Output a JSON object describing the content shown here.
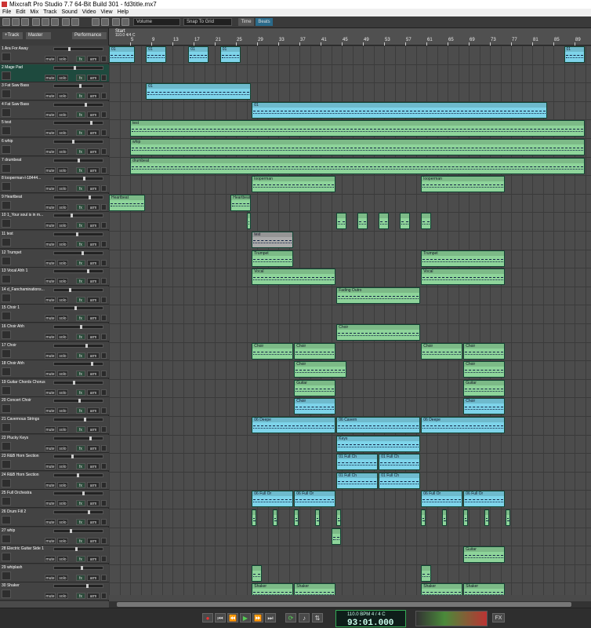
{
  "window": {
    "title": "Mixcraft Pro Studio 7.7 64-Bit Build 301 - fd3title.mx7"
  },
  "menu": [
    "File",
    "Edit",
    "Mix",
    "Track",
    "Sound",
    "Video",
    "View",
    "Help"
  ],
  "toolbar": {
    "volume_label": "Volume",
    "snap_label": "Snap To Grid",
    "time_tab": "Time",
    "beats_tab": "Beats"
  },
  "header": {
    "track_btn": "+Track",
    "master_btn": "Master",
    "performance_btn": "Performance"
  },
  "ruler": {
    "marker": "Start",
    "time": "110.0 4/4 C",
    "bars": [
      "5",
      "9",
      "13",
      "17",
      "21",
      "25",
      "29",
      "33",
      "37",
      "41",
      "45",
      "49",
      "53",
      "57",
      "61",
      "65",
      "69",
      "73",
      "77",
      "81",
      "85",
      "89"
    ]
  },
  "track_buttons": {
    "mute": "mute",
    "solo": "solo",
    "fx": "fx",
    "arm": "arm"
  },
  "tracks": [
    {
      "name": "1 Ara For Away",
      "color": "b"
    },
    {
      "name": "2 Mage Pad",
      "color": "b"
    },
    {
      "name": "3 Fat Saw Bass",
      "color": "b"
    },
    {
      "name": "4 Fat Saw Bass",
      "color": "b"
    },
    {
      "name": "5 test",
      "color": "g"
    },
    {
      "name": "6 whip",
      "color": "g"
    },
    {
      "name": "7 drumbeat",
      "color": "g"
    },
    {
      "name": "8 looperman-l-18444...",
      "color": "g"
    },
    {
      "name": "9 Heartbeat",
      "color": "g"
    },
    {
      "name": "10 1_Your soul is in m...",
      "color": "g"
    },
    {
      "name": "11 test",
      "color": "gr"
    },
    {
      "name": "12 Trumpet",
      "color": "g"
    },
    {
      "name": "13 Vocal Ahh 1",
      "color": "g"
    },
    {
      "name": "14 d_Fanchaminations...",
      "color": "g"
    },
    {
      "name": "15 Choir 1",
      "color": "g"
    },
    {
      "name": "16 Choir Ahh",
      "color": "g"
    },
    {
      "name": "17 Choir",
      "color": "g"
    },
    {
      "name": "18 Choir Ahh",
      "color": "g"
    },
    {
      "name": "19 Guitar Chords Chorus",
      "color": "g"
    },
    {
      "name": "20 Concert Choir",
      "color": "b"
    },
    {
      "name": "21 Cavernous Strings",
      "color": "b"
    },
    {
      "name": "22 Plucky Keys",
      "color": "b"
    },
    {
      "name": "23 R&B Horn Section",
      "color": "b"
    },
    {
      "name": "24 R&B Horn Section",
      "color": "b"
    },
    {
      "name": "25 Full Orchestra",
      "color": "b"
    },
    {
      "name": "26 Drum Fill 2",
      "color": "g"
    },
    {
      "name": "27 whip",
      "color": "g"
    },
    {
      "name": "28 Electric Guitar Side 1",
      "color": "g"
    },
    {
      "name": "29 whiplash",
      "color": "g"
    },
    {
      "name": "30 Shaker",
      "color": "g"
    }
  ],
  "clips": [
    {
      "t": 0,
      "s": 0,
      "e": 5,
      "c": "b",
      "l": "01"
    },
    {
      "t": 0,
      "s": 7,
      "e": 11,
      "c": "b",
      "l": "01"
    },
    {
      "t": 0,
      "s": 15,
      "e": 19,
      "c": "b",
      "l": "01"
    },
    {
      "t": 0,
      "s": 21,
      "e": 25,
      "c": "b",
      "l": "01"
    },
    {
      "t": 0,
      "s": 86,
      "e": 90,
      "c": "b",
      "l": "01"
    },
    {
      "t": 2,
      "s": 7,
      "e": 27,
      "c": "b",
      "l": "01"
    },
    {
      "t": 3,
      "s": 27,
      "e": 83,
      "c": "b",
      "l": "01"
    },
    {
      "t": 4,
      "s": 4,
      "e": 90,
      "c": "g",
      "l": "test"
    },
    {
      "t": 5,
      "s": 4,
      "e": 90,
      "c": "g",
      "l": "whip"
    },
    {
      "t": 6,
      "s": 4,
      "e": 90,
      "c": "g",
      "l": "drumbeat"
    },
    {
      "t": 7,
      "s": 27,
      "e": 43,
      "c": "g",
      "l": "looperman"
    },
    {
      "t": 7,
      "s": 59,
      "e": 75,
      "c": "g",
      "l": "looperman"
    },
    {
      "t": 8,
      "s": 0,
      "e": 7,
      "c": "g",
      "l": "Heartbeat"
    },
    {
      "t": 8,
      "s": 23,
      "e": 27,
      "c": "g",
      "l": "Heartbeat"
    },
    {
      "t": 9,
      "s": 26,
      "e": 27,
      "c": "g",
      "l": ""
    },
    {
      "t": 9,
      "s": 43,
      "e": 45,
      "c": "g",
      "l": ""
    },
    {
      "t": 9,
      "s": 47,
      "e": 49,
      "c": "g",
      "l": ""
    },
    {
      "t": 9,
      "s": 51,
      "e": 53,
      "c": "g",
      "l": ""
    },
    {
      "t": 9,
      "s": 55,
      "e": 57,
      "c": "g",
      "l": ""
    },
    {
      "t": 9,
      "s": 59,
      "e": 61,
      "c": "g",
      "l": ""
    },
    {
      "t": 10,
      "s": 27,
      "e": 35,
      "c": "gr",
      "l": "test"
    },
    {
      "t": 11,
      "s": 27,
      "e": 35,
      "c": "g",
      "l": "Trumpet"
    },
    {
      "t": 11,
      "s": 59,
      "e": 75,
      "c": "g",
      "l": "Trumpet"
    },
    {
      "t": 12,
      "s": 27,
      "e": 43,
      "c": "g",
      "l": "Vocal"
    },
    {
      "t": 12,
      "s": 59,
      "e": 75,
      "c": "g",
      "l": "Vocal"
    },
    {
      "t": 13,
      "s": 43,
      "e": 59,
      "c": "g",
      "l": "Fading Outro"
    },
    {
      "t": 15,
      "s": 43,
      "e": 59,
      "c": "g",
      "l": "Choir"
    },
    {
      "t": 16,
      "s": 27,
      "e": 35,
      "c": "g",
      "l": "Choir"
    },
    {
      "t": 16,
      "s": 35,
      "e": 43,
      "c": "g",
      "l": "Choir"
    },
    {
      "t": 16,
      "s": 59,
      "e": 67,
      "c": "g",
      "l": "Choir"
    },
    {
      "t": 16,
      "s": 67,
      "e": 75,
      "c": "g",
      "l": "Choir"
    },
    {
      "t": 17,
      "s": 35,
      "e": 45,
      "c": "g",
      "l": "Choir"
    },
    {
      "t": 17,
      "s": 67,
      "e": 75,
      "c": "g",
      "l": "Choir"
    },
    {
      "t": 18,
      "s": 35,
      "e": 43,
      "c": "g",
      "l": "Guitar"
    },
    {
      "t": 18,
      "s": 67,
      "e": 75,
      "c": "g",
      "l": "Guitar"
    },
    {
      "t": 19,
      "s": 35,
      "e": 43,
      "c": "b",
      "l": "Choir"
    },
    {
      "t": 19,
      "s": 67,
      "e": 75,
      "c": "b",
      "l": "Choir"
    },
    {
      "t": 20,
      "s": 27,
      "e": 43,
      "c": "b",
      "l": "06 Deepe"
    },
    {
      "t": 20,
      "s": 43,
      "e": 59,
      "c": "b",
      "l": "06 Cavern"
    },
    {
      "t": 20,
      "s": 59,
      "e": 75,
      "c": "b",
      "l": "06 Deepe"
    },
    {
      "t": 21,
      "s": 43,
      "e": 59,
      "c": "b",
      "l": "Keys"
    },
    {
      "t": 22,
      "s": 43,
      "e": 51,
      "c": "b",
      "l": "01 Full Ch"
    },
    {
      "t": 22,
      "s": 51,
      "e": 59,
      "c": "b",
      "l": "01 Full Ch"
    },
    {
      "t": 23,
      "s": 43,
      "e": 51,
      "c": "b",
      "l": "01 Full Ch"
    },
    {
      "t": 23,
      "s": 51,
      "e": 59,
      "c": "b",
      "l": "01 Full Ch"
    },
    {
      "t": 24,
      "s": 27,
      "e": 35,
      "c": "b",
      "l": "06 Full Or"
    },
    {
      "t": 24,
      "s": 35,
      "e": 43,
      "c": "b",
      "l": "06 Full Or"
    },
    {
      "t": 24,
      "s": 59,
      "e": 67,
      "c": "b",
      "l": "06 Full Or"
    },
    {
      "t": 24,
      "s": 67,
      "e": 75,
      "c": "b",
      "l": "06 Full Or"
    },
    {
      "t": 25,
      "s": 27,
      "e": 28,
      "c": "g",
      "l": ""
    },
    {
      "t": 25,
      "s": 31,
      "e": 32,
      "c": "g",
      "l": ""
    },
    {
      "t": 25,
      "s": 35,
      "e": 36,
      "c": "g",
      "l": ""
    },
    {
      "t": 25,
      "s": 39,
      "e": 40,
      "c": "g",
      "l": ""
    },
    {
      "t": 25,
      "s": 43,
      "e": 44,
      "c": "g",
      "l": ""
    },
    {
      "t": 25,
      "s": 59,
      "e": 60,
      "c": "g",
      "l": ""
    },
    {
      "t": 25,
      "s": 63,
      "e": 64,
      "c": "g",
      "l": ""
    },
    {
      "t": 25,
      "s": 67,
      "e": 68,
      "c": "g",
      "l": ""
    },
    {
      "t": 25,
      "s": 71,
      "e": 72,
      "c": "g",
      "l": ""
    },
    {
      "t": 25,
      "s": 75,
      "e": 76,
      "c": "g",
      "l": ""
    },
    {
      "t": 26,
      "s": 42,
      "e": 44,
      "c": "g",
      "l": ""
    },
    {
      "t": 27,
      "s": 67,
      "e": 75,
      "c": "g",
      "l": "Guitar"
    },
    {
      "t": 28,
      "s": 27,
      "e": 29,
      "c": "g",
      "l": ""
    },
    {
      "t": 28,
      "s": 59,
      "e": 61,
      "c": "g",
      "l": ""
    },
    {
      "t": 29,
      "s": 27,
      "e": 35,
      "c": "g",
      "l": "Shaker"
    },
    {
      "t": 29,
      "s": 35,
      "e": 43,
      "c": "g",
      "l": "Shaker"
    },
    {
      "t": 29,
      "s": 59,
      "e": 67,
      "c": "g",
      "l": "Shaker"
    },
    {
      "t": 29,
      "s": 67,
      "e": 75,
      "c": "g",
      "l": "Shaker"
    }
  ],
  "transport": {
    "tempo_line": "110.0 BPM  4 / 4    C",
    "position": "93:01.000",
    "fx_label": "FX"
  }
}
